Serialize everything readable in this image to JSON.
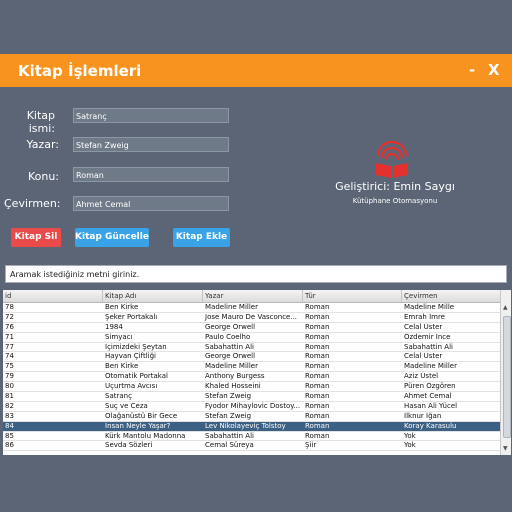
{
  "window": {
    "title": "Kitap İşlemleri",
    "minimize": "-",
    "close": "X"
  },
  "form": {
    "fields": [
      {
        "label": "Kitap ismi:",
        "value": "Satranç"
      },
      {
        "label": "Yazar:",
        "value": "Stefan Zweig"
      },
      {
        "label": "Konu:",
        "value": "Roman"
      },
      {
        "label": "Çevirmen:",
        "value": "Ahmet Cemal"
      }
    ]
  },
  "buttons": {
    "delete": "Kitap Sil",
    "update": "Kitap Güncelle",
    "add": "Kitap Ekle"
  },
  "colors": {
    "titlebar": "#f7931e",
    "background": "#5b6575",
    "delete_button": "#e94b4b",
    "primary_button": "#3aa3e8",
    "selected_row": "#3d6185",
    "logo": "#e3312d"
  },
  "brand": {
    "developer": "Geliştirici: Emin Saygı",
    "app_name": "Kütüphane Otomasyonu",
    "logo_icon": "book-wifi-icon"
  },
  "search": {
    "placeholder": "Aramak istediğiniz metni giriniz."
  },
  "table": {
    "columns": [
      "id",
      "Kitap Adı",
      "Yazar",
      "Tür",
      "Çevirmen"
    ],
    "selected_index": 12,
    "rows": [
      [
        "78",
        "Ben Kirke",
        "Madeline Miller",
        "Roman",
        "Madeline Mille"
      ],
      [
        "72",
        "Şeker Portakalı",
        "Jose Mauro De Vasconce...",
        "Roman",
        "Emrah İmre"
      ],
      [
        "76",
        "1984",
        "George Orwell",
        "Roman",
        "Celal Üster"
      ],
      [
        "71",
        "Simyacı",
        "Paulo Coelho",
        "Roman",
        "Özdemir İnce"
      ],
      [
        "77",
        "İçimizdeki Şeytan",
        "Sabahattin Ali",
        "Roman",
        "Sabahattin Ali"
      ],
      [
        "74",
        "Hayvan Çiftliği",
        "George Orwell",
        "Roman",
        "Celal Üster"
      ],
      [
        "75",
        "Ben Kirke",
        "Madeline Miller",
        "Roman",
        "Madeline Miller"
      ],
      [
        "79",
        "Otomatik Portakal",
        "Anthony Burgess",
        "Roman",
        "Aziz Üstel"
      ],
      [
        "80",
        "Uçurtma Avcısı",
        "Khaled Hosseini",
        "Roman",
        "Püren Özgören"
      ],
      [
        "81",
        "Satranç",
        "Stefan Zweig",
        "Roman",
        "Ahmet Cemal"
      ],
      [
        "82",
        "Suç ve Ceza",
        "Fyodor Mihaylovic Dostoy...",
        "Roman",
        "Hasan Ali Yücel"
      ],
      [
        "83",
        "Olağanüstü Bir Gece",
        "Stefan Zweig",
        "Roman",
        "İlknur İğan"
      ],
      [
        "84",
        "İnsan Neyle Yaşar?",
        "Lev Nikolayeviç Tolstoy",
        "Roman",
        "Koray Karasulu"
      ],
      [
        "85",
        "Kürk Mantolu Madonna",
        "Sabahattin Ali",
        "Roman",
        "Yok"
      ],
      [
        "86",
        "Sevda Sözleri",
        "Cemal Süreya",
        "Şiir",
        "Yok"
      ]
    ]
  }
}
